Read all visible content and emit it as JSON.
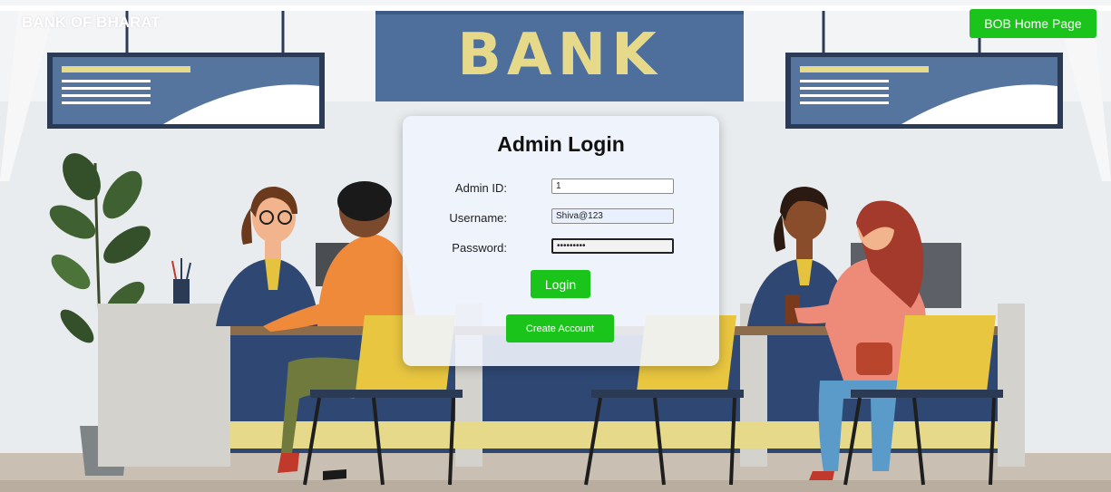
{
  "header": {
    "brand": "BANK OF BHARAT",
    "home_button": "BOB Home Page"
  },
  "banner": {
    "sign_text": "BANK"
  },
  "login": {
    "title": "Admin Login",
    "fields": {
      "admin_id": {
        "label": "Admin ID:",
        "value": "1"
      },
      "username": {
        "label": "Username:",
        "value": "Shiva@123"
      },
      "password": {
        "label": "Password:",
        "value": "•••••••••"
      }
    },
    "login_button": "Login",
    "create_button": "Create Account"
  },
  "colors": {
    "button_green": "#1bc41b",
    "sign_blue": "#4e6f9c",
    "sign_yellow": "#e6da8a",
    "counter_navy": "#2f4873",
    "chair_yellow": "#e8c640"
  }
}
